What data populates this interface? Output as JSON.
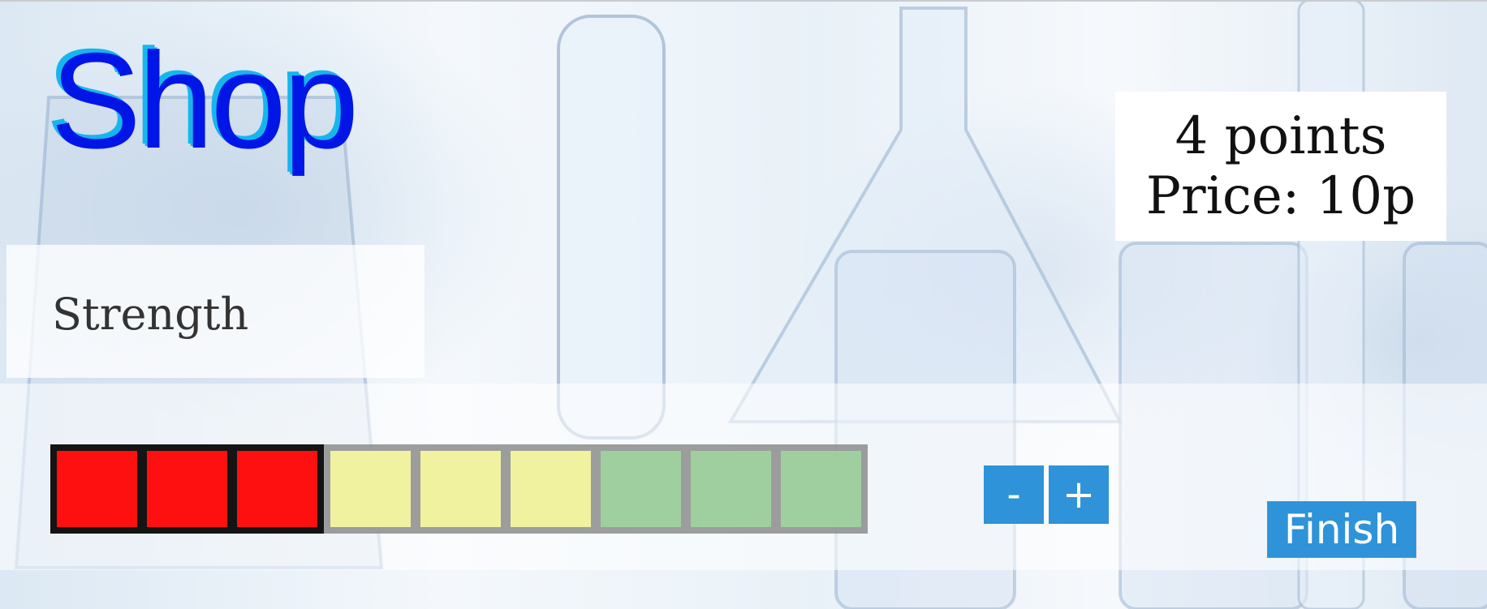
{
  "title": "Shop",
  "points_box": {
    "points_text": "4 points",
    "price_text": "Price: 10p"
  },
  "stat": {
    "label": "Strength",
    "level": 3,
    "max_level": 9,
    "segment_colors": {
      "filled": "#ff1010",
      "low": "#f8faa0",
      "high": "#a0d4a0"
    }
  },
  "buttons": {
    "minus": "-",
    "plus": "+",
    "finish": "Finish"
  },
  "colors": {
    "title": "#0016e6",
    "title_shadow": "#15b6ee",
    "button": "#2e93d8"
  }
}
